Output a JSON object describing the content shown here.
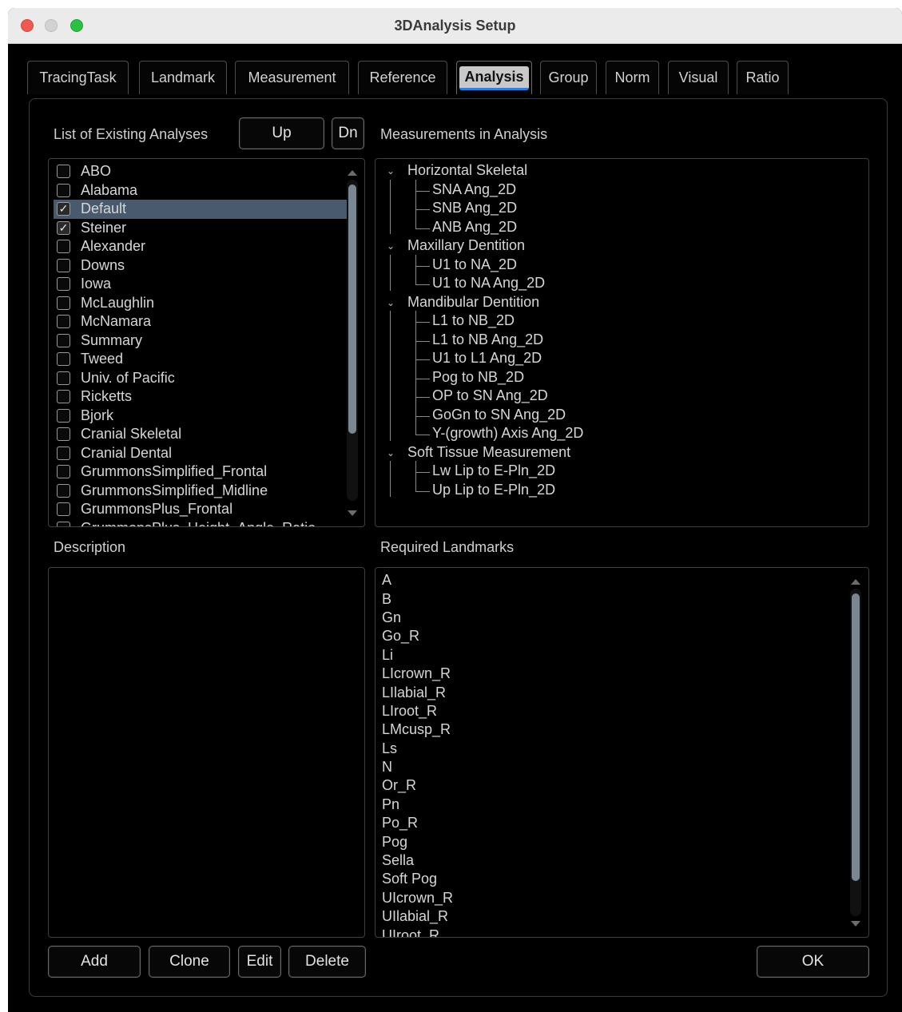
{
  "window": {
    "title": "3DAnalysis Setup"
  },
  "tabs": [
    {
      "label": "TracingTask",
      "active": false
    },
    {
      "label": "Landmark",
      "active": false
    },
    {
      "label": "Measurement",
      "active": false
    },
    {
      "label": "Reference",
      "active": false
    },
    {
      "label": "Analysis",
      "active": true
    },
    {
      "label": "Group",
      "active": false
    },
    {
      "label": "Norm",
      "active": false
    },
    {
      "label": "Visual",
      "active": false
    },
    {
      "label": "Ratio",
      "active": false
    }
  ],
  "analyses": {
    "header": "List of Existing Analyses",
    "up_label": "Up",
    "dn_label": "Dn",
    "items": [
      {
        "label": "ABO",
        "checked": false,
        "selected": false
      },
      {
        "label": "Alabama",
        "checked": false,
        "selected": false
      },
      {
        "label": "Default",
        "checked": true,
        "selected": true
      },
      {
        "label": "Steiner",
        "checked": true,
        "selected": false
      },
      {
        "label": "Alexander",
        "checked": false,
        "selected": false
      },
      {
        "label": "Downs",
        "checked": false,
        "selected": false
      },
      {
        "label": "Iowa",
        "checked": false,
        "selected": false
      },
      {
        "label": "McLaughlin",
        "checked": false,
        "selected": false
      },
      {
        "label": "McNamara",
        "checked": false,
        "selected": false
      },
      {
        "label": "Summary",
        "checked": false,
        "selected": false
      },
      {
        "label": "Tweed",
        "checked": false,
        "selected": false
      },
      {
        "label": "Univ. of Pacific",
        "checked": false,
        "selected": false
      },
      {
        "label": "Ricketts",
        "checked": false,
        "selected": false
      },
      {
        "label": "Bjork",
        "checked": false,
        "selected": false
      },
      {
        "label": "Cranial Skeletal",
        "checked": false,
        "selected": false
      },
      {
        "label": "Cranial Dental",
        "checked": false,
        "selected": false
      },
      {
        "label": "GrummonsSimplified_Frontal",
        "checked": false,
        "selected": false
      },
      {
        "label": "GrummonsSimplified_Midline",
        "checked": false,
        "selected": false
      },
      {
        "label": "GrummonsPlus_Frontal",
        "checked": false,
        "selected": false
      },
      {
        "label": "GrummonsPlus_Height_Angle_Ratio",
        "checked": false,
        "selected": false
      }
    ]
  },
  "measurements": {
    "header": "Measurements in Analysis",
    "groups": [
      {
        "label": "Horizontal Skeletal",
        "items": [
          "SNA Ang_2D",
          "SNB Ang_2D",
          "ANB Ang_2D"
        ]
      },
      {
        "label": "Maxillary Dentition",
        "items": [
          "U1 to NA_2D",
          "U1 to NA Ang_2D"
        ]
      },
      {
        "label": "Mandibular Dentition",
        "items": [
          "L1 to NB_2D",
          "L1 to NB Ang_2D",
          "U1 to L1 Ang_2D",
          "Pog to NB_2D",
          "OP to SN Ang_2D",
          "GoGn to SN Ang_2D",
          "Y-(growth) Axis Ang_2D"
        ]
      },
      {
        "label": "Soft Tissue Measurement",
        "items": [
          "Lw Lip to E-Pln_2D",
          "Up Lip to E-Pln_2D"
        ]
      }
    ]
  },
  "description": {
    "header": "Description",
    "text": ""
  },
  "landmarks": {
    "header": "Required Landmarks",
    "items": [
      "A",
      "B",
      "Gn",
      "Go_R",
      "Li",
      "LIcrown_R",
      "LIlabial_R",
      "LIroot_R",
      "LMcusp_R",
      "Ls",
      "N",
      "Or_R",
      "Pn",
      "Po_R",
      "Pog",
      "Sella",
      "Soft Pog",
      "UIcrown_R",
      "UIlabial_R",
      "UIroot_R"
    ]
  },
  "buttons": {
    "add": "Add",
    "clone": "Clone",
    "edit": "Edit",
    "delete": "Delete",
    "ok": "OK"
  }
}
